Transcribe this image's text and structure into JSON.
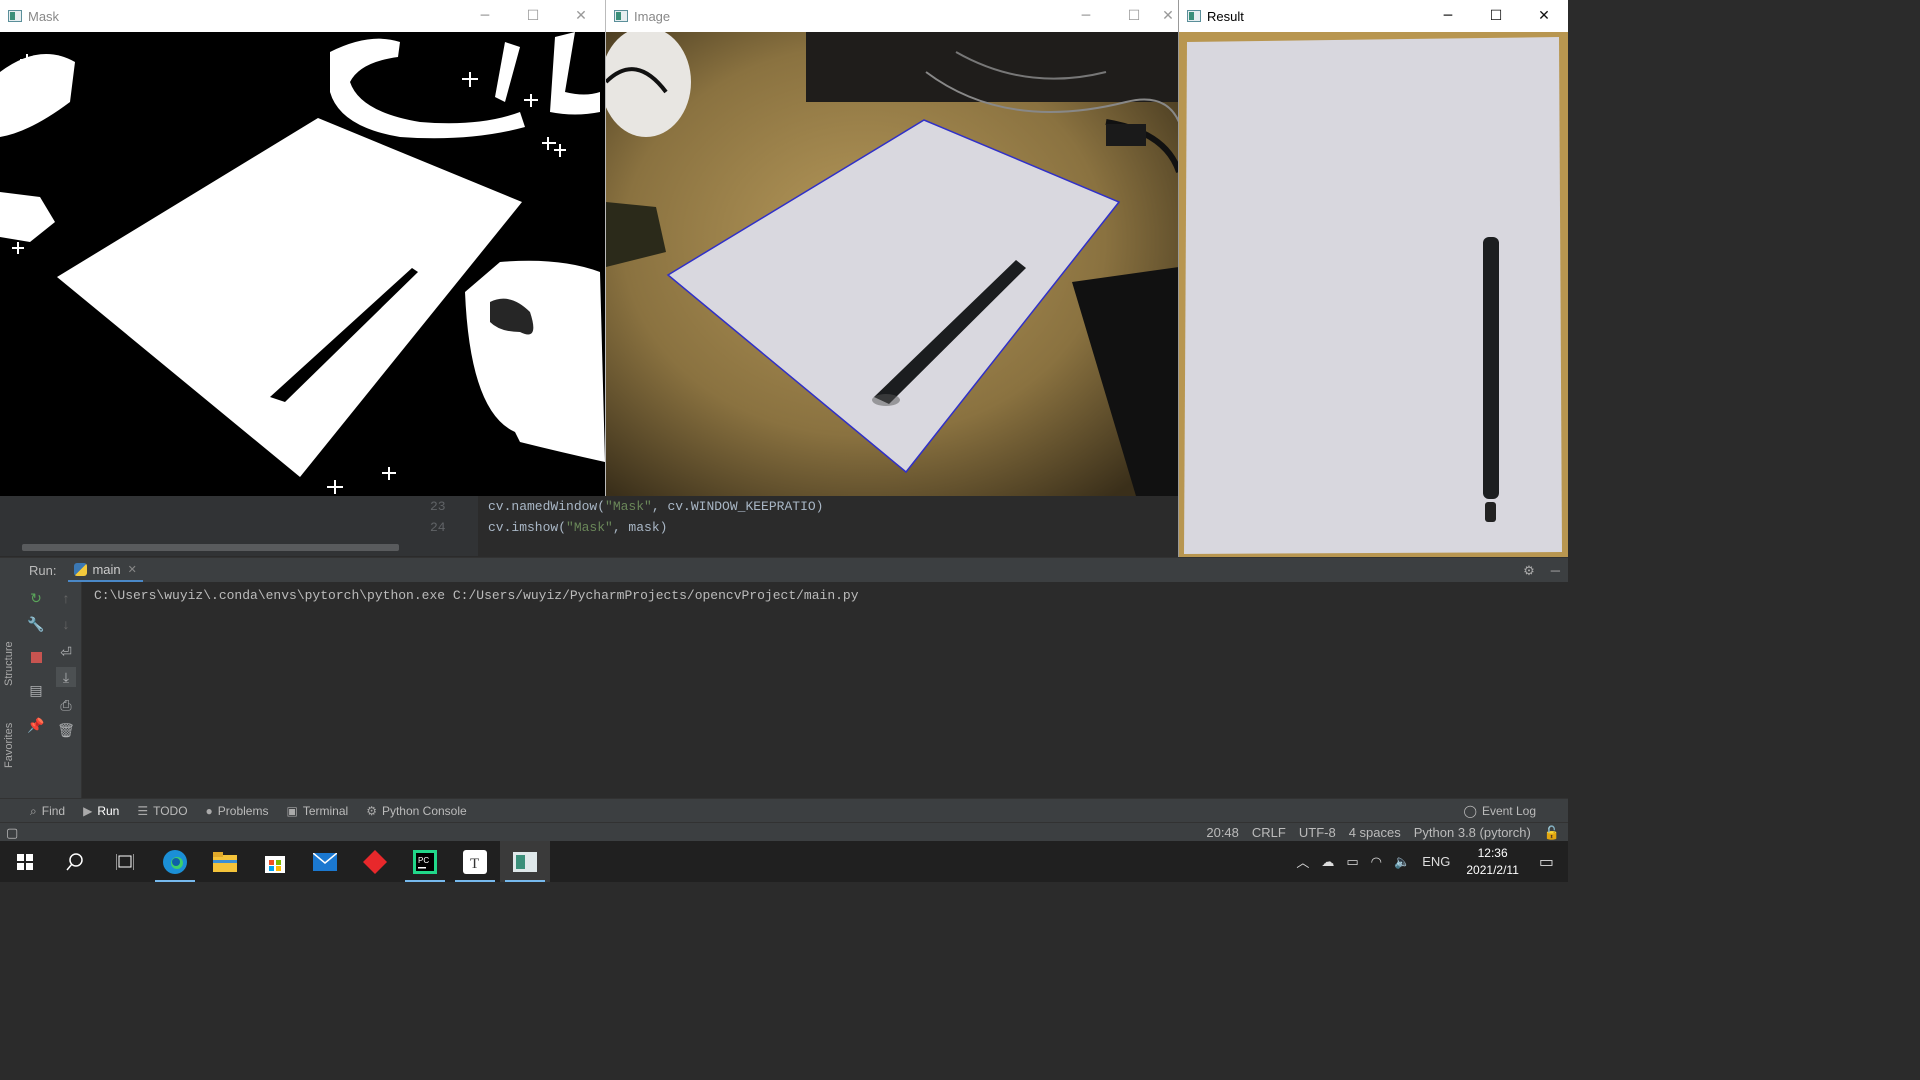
{
  "windows": {
    "mask": {
      "title": "Mask"
    },
    "image": {
      "title": "Image"
    },
    "result": {
      "title": "Result"
    },
    "controls": {
      "minimize": "─",
      "maximize": "☐",
      "close": "✕"
    }
  },
  "editor": {
    "lines": [
      {
        "num": "23",
        "pre": "cv.namedWindow(",
        "str": "\"Mask\"",
        "post": ", cv.WINDOW_KEEPRATIO)"
      },
      {
        "num": "24",
        "pre": "cv.imshow(",
        "str": "\"Mask\"",
        "post": ", mask)"
      }
    ]
  },
  "run": {
    "label": "Run:",
    "tab": "main",
    "command": "C:\\Users\\wuyiz\\.conda\\envs\\pytorch\\python.exe C:/Users/wuyiz/PycharmProjects/opencvProject/main.py"
  },
  "sidebar": {
    "structure": "Structure",
    "favorites": "Favorites"
  },
  "bottom_tabs": {
    "find": "Find",
    "run": "Run",
    "todo": "TODO",
    "problems": "Problems",
    "terminal": "Terminal",
    "python_console": "Python Console",
    "event_log": "Event Log"
  },
  "status": {
    "position": "20:48",
    "line_sep": "CRLF",
    "encoding": "UTF-8",
    "indent": "4 spaces",
    "interpreter": "Python 3.8 (pytorch)"
  },
  "taskbar": {
    "lang": "ENG",
    "time": "12:36",
    "date": "2021/2/11",
    "apps": [
      "windows-start",
      "search",
      "task-view",
      "edge",
      "file-explorer",
      "store",
      "mail",
      "app-red",
      "pycharm",
      "typora",
      "opencv-viewer"
    ]
  }
}
